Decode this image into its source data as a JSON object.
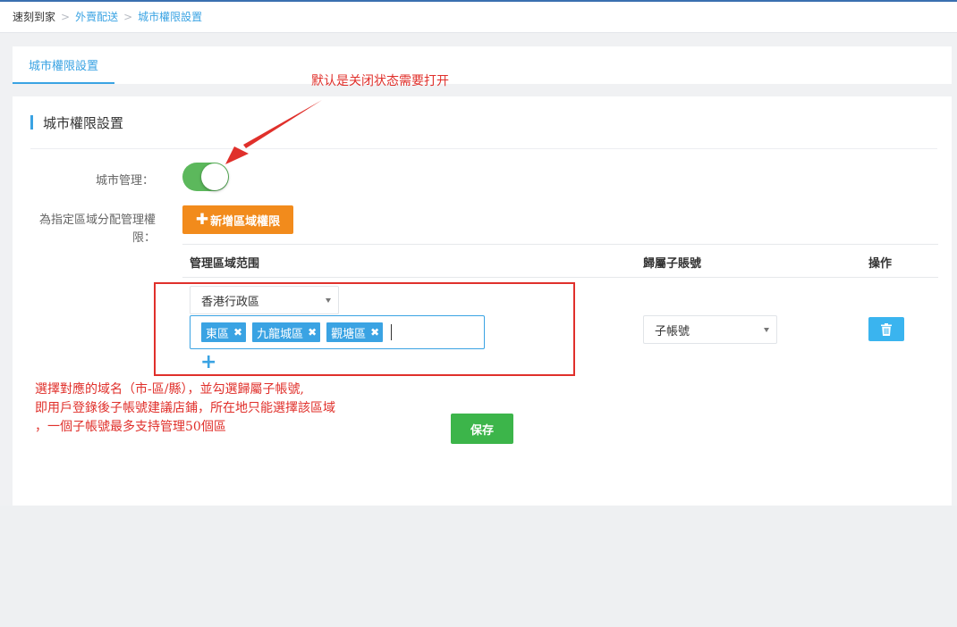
{
  "breadcrumb": {
    "items": [
      "速刻到家",
      "外賣配送",
      "城市權限設置"
    ]
  },
  "tabs": [
    {
      "label": "城市權限設置",
      "active": true
    }
  ],
  "section": {
    "title": "城市權限設置"
  },
  "form": {
    "city_management_label": "城市管理：",
    "city_management_enabled": true,
    "assign_label_line1": "為指定區域分配管理權",
    "assign_label_line2": "限：",
    "add_button_label": "新增區域權限"
  },
  "table": {
    "columns": [
      "管理區域范围",
      "歸屬子賬號",
      "操作"
    ],
    "rows": [
      {
        "region": "香港行政區",
        "districts": [
          "東區",
          "九龍城區",
          "觀塘區"
        ],
        "sub_account": "子帳號"
      }
    ]
  },
  "save_button_label": "保存",
  "annotations": {
    "callout": "默认是关闭状态需要打开",
    "note_line1": "選擇對應的域名（市-區/縣），並勾選歸屬子帳號,",
    "note_line2": "即用戶登錄後子帳號建議店鋪，所在地只能選擇該區域",
    "note_line3": "，一個子帳號最多支持管理50個區"
  },
  "colors": {
    "accent": "#3aa3e3",
    "toggle_on": "#5cb85c",
    "add_button": "#f28b1c",
    "save_button": "#3cb54a",
    "annotation_red": "#e0302b"
  }
}
